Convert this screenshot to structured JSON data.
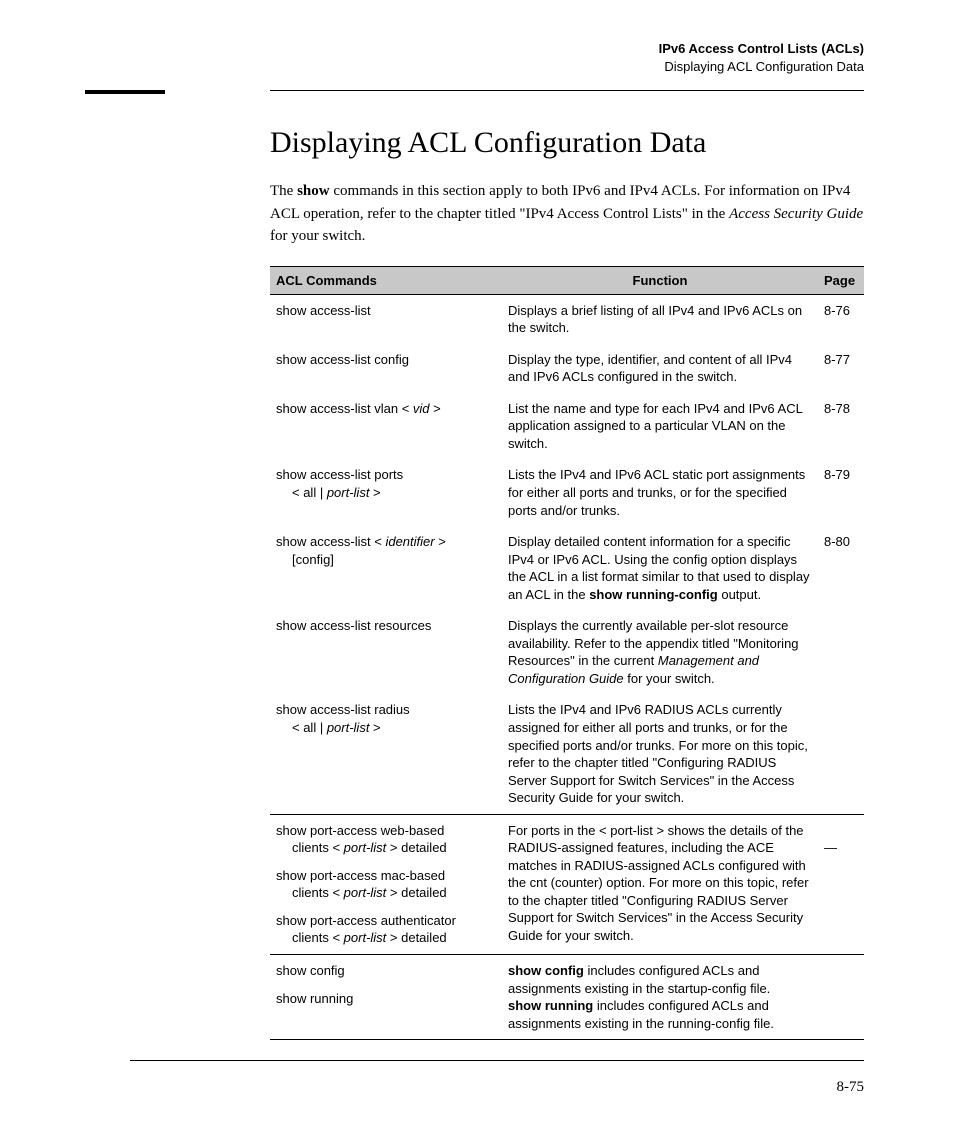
{
  "header": {
    "line1": "IPv6 Access Control Lists (ACLs)",
    "line2": "Displaying ACL Configuration Data"
  },
  "title": "Displaying ACL Configuration Data",
  "intro": {
    "pre": "The ",
    "bold1": "show",
    "mid1": " commands in this section apply to both IPv6 and IPv4 ACLs. For information on IPv4 ACL operation, refer to the chapter titled \"IPv4 Access Control Lists\" in the ",
    "ital1": "Access Security Guide",
    "post": " for your switch."
  },
  "table": {
    "head": {
      "c1": "ACL Commands",
      "c2": "Function",
      "c3": "Page"
    },
    "rows": [
      {
        "cmd": "show access-list",
        "func": "Displays a brief listing of all IPv4 and IPv6 ACLs on the switch.",
        "page": "8-76"
      },
      {
        "cmd": "show access-list config",
        "func": "Display the type, identifier, and content of all IPv4 and IPv6 ACLs configured in the switch.",
        "page": "8-77"
      },
      {
        "cmd_pre": "show access-list vlan < ",
        "cmd_ital": "vid",
        "cmd_post": " >",
        "func": "List the name and type for each IPv4 and IPv6 ACL application assigned to a particular VLAN on the switch.",
        "page": "8-78"
      },
      {
        "cmd_line1": "show access-list ports",
        "cmd_sub_pre": "< all | ",
        "cmd_sub_ital": "port-list",
        "cmd_sub_post": " >",
        "func": "Lists the IPv4 and IPv6 ACL static port assignments for either all ports and trunks, or for the specified ports and/or trunks.",
        "page": "8-79"
      },
      {
        "cmd_pre": "show access-list < ",
        "cmd_ital": "identifier",
        "cmd_post": " >",
        "cmd_sub": "[config]",
        "func_pre": "Display detailed content information for a specific IPv4 or IPv6 ACL. Using the config option displays the ACL in a list format similar to that used to display an ACL in the ",
        "func_bold": "show running-config",
        "func_post": " output.",
        "page": "8-80"
      },
      {
        "cmd": "show access-list resources",
        "func_pre": "Displays the currently available per-slot resource availability. Refer to the appendix titled \"Monitoring Resources\" in the current ",
        "func_ital": "Management and Configuration Guide",
        "func_post": " for your switch.",
        "page": ""
      },
      {
        "cmd_line1": "show access-list radius",
        "cmd_sub_pre": "< all | ",
        "cmd_sub_ital": "port-list",
        "cmd_sub_post": " >",
        "func": "Lists the IPv4 and IPv6 RADIUS ACLs currently assigned for either all ports and trunks, or for the specified ports and/or trunks. For more on this topic, refer to the chapter titled \"Configuring RADIUS Server Support for Switch Services\" in the Access Security Guide for your switch.",
        "page": ""
      }
    ],
    "group2": {
      "cmds": [
        {
          "line1": "show port-access web-based",
          "sub_pre": "clients < ",
          "sub_ital": "port-list",
          "sub_post": " > detailed"
        },
        {
          "line1": "show port-access mac-based",
          "sub_pre": "clients < ",
          "sub_ital": "port-list",
          "sub_post": " > detailed"
        },
        {
          "line1": "show port-access authenticator",
          "sub_pre": "clients < ",
          "sub_ital": "port-list",
          "sub_post": " > detailed"
        }
      ],
      "func": "For ports in the < port-list > shows the details of the RADIUS-assigned features, including the ACE matches in RADIUS-assigned ACLs configured with the cnt (counter) option.  For more on this topic, refer to the chapter titled \"Configuring RADIUS Server Support for Switch Services\" in the Access Security Guide for your switch.",
      "page": "—"
    },
    "group3": {
      "cmd1": "show config",
      "cmd2": "show running",
      "func_b1": "show config",
      "func_t1": " includes configured ACLs and assignments existing in the startup-config file.",
      "func_b2": "show running",
      "func_t2": " includes configured ACLs and assignments existing in the running-config file.",
      "page": ""
    }
  },
  "page_number": "8-75"
}
